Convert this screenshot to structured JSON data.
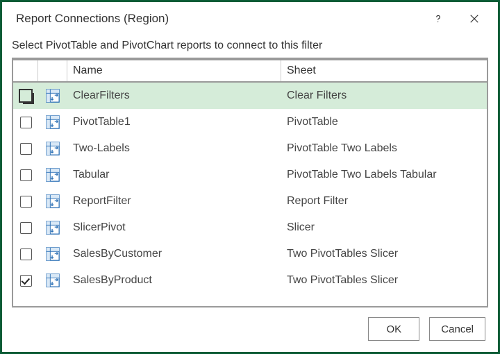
{
  "window": {
    "title": "Report Connections (Region)"
  },
  "instruction": "Select PivotTable and PivotChart reports to connect to this filter",
  "headers": {
    "name": "Name",
    "sheet": "Sheet"
  },
  "rows": [
    {
      "checked": false,
      "selected": true,
      "name": "ClearFilters",
      "sheet": "Clear Filters"
    },
    {
      "checked": false,
      "selected": false,
      "name": "PivotTable1",
      "sheet": "PivotTable"
    },
    {
      "checked": false,
      "selected": false,
      "name": "Two-Labels",
      "sheet": "PivotTable Two Labels"
    },
    {
      "checked": false,
      "selected": false,
      "name": "Tabular",
      "sheet": "PivotTable Two Labels Tabular"
    },
    {
      "checked": false,
      "selected": false,
      "name": "ReportFilter",
      "sheet": "Report Filter"
    },
    {
      "checked": false,
      "selected": false,
      "name": "SlicerPivot",
      "sheet": "Slicer"
    },
    {
      "checked": false,
      "selected": false,
      "name": "SalesByCustomer",
      "sheet": "Two PivotTables Slicer"
    },
    {
      "checked": true,
      "selected": false,
      "name": "SalesByProduct",
      "sheet": "Two PivotTables Slicer"
    }
  ],
  "buttons": {
    "ok": "OK",
    "cancel": "Cancel"
  }
}
